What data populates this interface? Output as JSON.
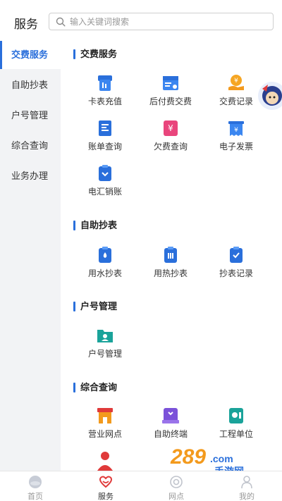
{
  "header": {
    "title": "服务",
    "search_placeholder": "输入关键词搜索"
  },
  "sidebar": {
    "items": [
      {
        "label": "交费服务",
        "active": true
      },
      {
        "label": "自助抄表",
        "active": false
      },
      {
        "label": "户号管理",
        "active": false
      },
      {
        "label": "综合查询",
        "active": false
      },
      {
        "label": "业务办理",
        "active": false
      }
    ]
  },
  "sections": [
    {
      "title": "交费服务",
      "items": [
        {
          "label": "卡表充值",
          "icon": "card-meter-icon"
        },
        {
          "label": "后付费交费",
          "icon": "postpaid-icon"
        },
        {
          "label": "交费记录",
          "icon": "payment-record-icon"
        },
        {
          "label": "账单查询",
          "icon": "bill-icon"
        },
        {
          "label": "欠费查询",
          "icon": "arrears-icon"
        },
        {
          "label": "电子发票",
          "icon": "e-invoice-icon"
        },
        {
          "label": "电汇销账",
          "icon": "wire-transfer-icon"
        }
      ]
    },
    {
      "title": "自助抄表",
      "items": [
        {
          "label": "用水抄表",
          "icon": "water-meter-icon"
        },
        {
          "label": "用热抄表",
          "icon": "heat-meter-icon"
        },
        {
          "label": "抄表记录",
          "icon": "meter-record-icon"
        }
      ]
    },
    {
      "title": "户号管理",
      "items": [
        {
          "label": "户号管理",
          "icon": "account-folder-icon"
        }
      ]
    },
    {
      "title": "综合查询",
      "items": [
        {
          "label": "营业网点",
          "icon": "branch-icon"
        },
        {
          "label": "自助终端",
          "icon": "terminal-icon"
        },
        {
          "label": "工程单位",
          "icon": "engineering-icon"
        }
      ]
    }
  ],
  "tabbar": {
    "items": [
      {
        "label": "首页",
        "active": false
      },
      {
        "label": "服务",
        "active": true
      },
      {
        "label": "网点",
        "active": false
      },
      {
        "label": "我的",
        "active": false
      }
    ]
  },
  "watermark": {
    "text": "289 手游网"
  },
  "colors": {
    "accent": "#2a6fdb",
    "sidebar_bg": "#f2f3f5",
    "red": "#e03a3a",
    "orange": "#f39a1d",
    "pink": "#e9457c",
    "purple": "#7b52d9",
    "teal": "#1aa39a"
  }
}
